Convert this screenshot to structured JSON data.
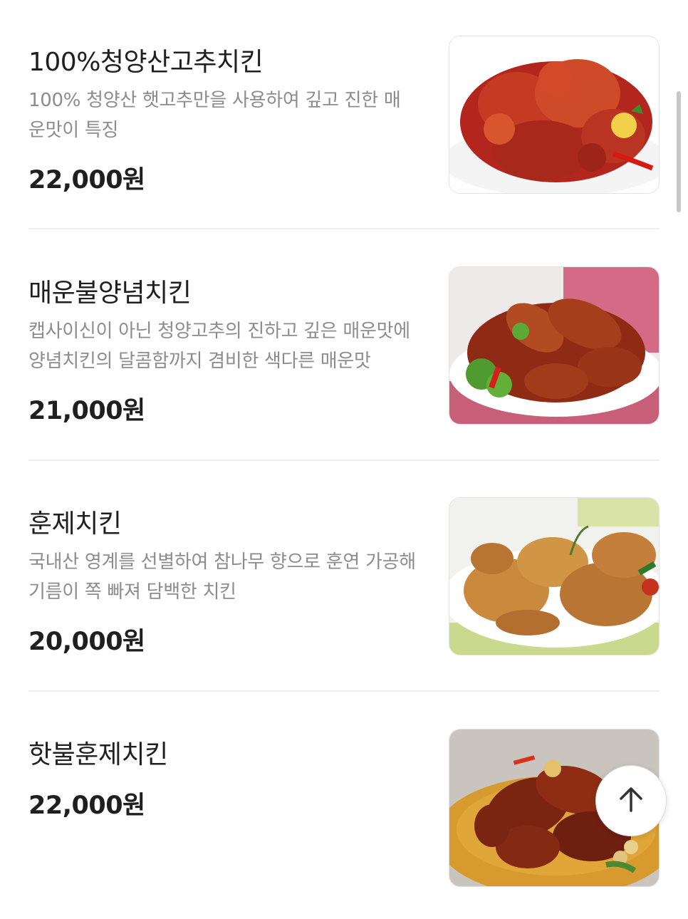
{
  "menu": {
    "items": [
      {
        "name": "100%청양산고추치킨",
        "description": "100% 청양산 햇고추만을 사용하여 깊고 진한 매운맛이 특징",
        "price": "22,000원",
        "image": "spicy-red-fried-chicken-photo"
      },
      {
        "name": "매운불양념치킨",
        "description": "캡사이신이 아닌 청양고추의 진하고 깊은 매운맛에 양념치킨의 달콤함까지 겸비한 색다른 매운맛",
        "price": "21,000원",
        "image": "sauced-drumsticks-photo"
      },
      {
        "name": "훈제치킨",
        "description": "국내산 영계를 선별하여 참나무 향으로 훈연 가공해 기름이 쪽 빠져 담백한 치킨",
        "price": "20,000원",
        "image": "smoked-chicken-photo"
      },
      {
        "name": "핫불훈제치킨",
        "description": "",
        "price": "22,000원",
        "image": "glazed-spicy-drumsticks-photo"
      }
    ]
  },
  "controls": {
    "scroll_top_icon": "arrow-up-icon"
  }
}
